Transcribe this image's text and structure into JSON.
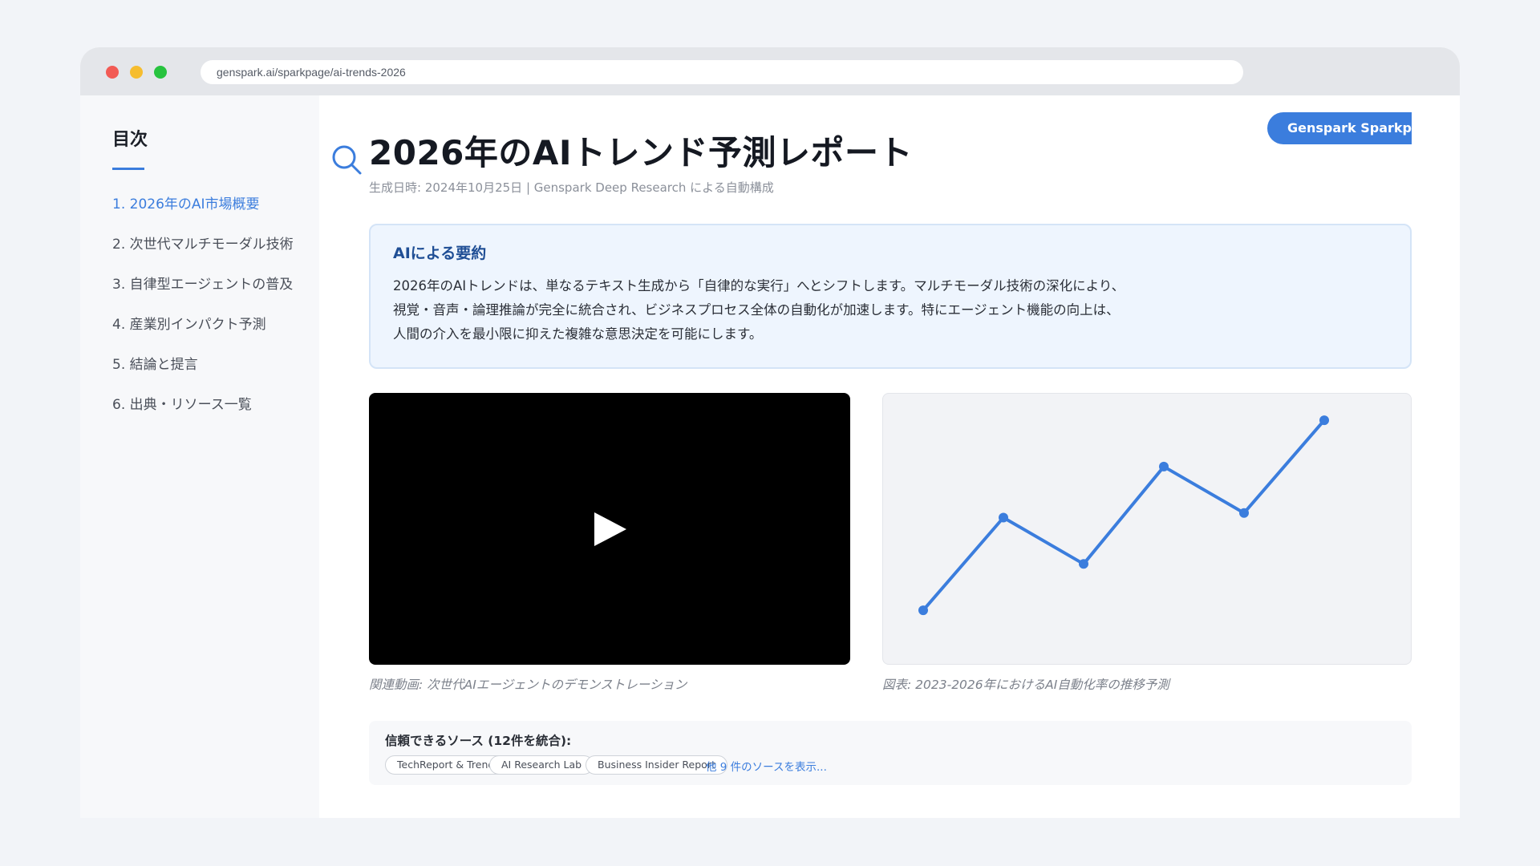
{
  "browser": {
    "url": "genspark.ai/sparkpage/ai-trends-2026"
  },
  "sidebar": {
    "title": "目次",
    "items": [
      {
        "label": "1. 2026年のAI市場概要",
        "active": true
      },
      {
        "label": "2. 次世代マルチモーダル技術",
        "active": false
      },
      {
        "label": "3. 自律型エージェントの普及",
        "active": false
      },
      {
        "label": "4. 産業別インパクト予測",
        "active": false
      },
      {
        "label": "5. 結論と提言",
        "active": false
      },
      {
        "label": "6. 出典・リソース一覧",
        "active": false
      }
    ]
  },
  "header": {
    "title": "2026年のAIトレンド予測レポート",
    "meta": "生成日時: 2024年10月25日 | Genspark Deep Research による自動構成",
    "cta_label": "Genspark Sparkpage",
    "search_icon": "search-icon"
  },
  "summary": {
    "title": "AIによる要約",
    "lines": [
      "2026年のAIトレンドは、単なるテキスト生成から「自律的な実行」へとシフトします。マルチモーダル技術の深化により、",
      "視覚・音声・論理推論が完全に統合され、ビジネスプロセス全体の自動化が加速します。特にエージェント機能の向上は、",
      "人間の介入を最小限に抑えた複雑な意思決定を可能にします。"
    ]
  },
  "media": {
    "video_caption": "関連動画: 次世代AIエージェントのデモンストレーション",
    "play_icon": "play-icon",
    "chart_caption": "図表: 2023-2026年におけるAI自動化率の推移予測"
  },
  "sources": {
    "label": "信頼できるソース (12件を統合):",
    "chips": [
      "TechReport & Trends",
      "AI Research Lab",
      "Business Insider Report"
    ],
    "more_link": "他 9 件のソースを表示..."
  },
  "colors": {
    "accent": "#3b7ddd",
    "summary_bg": "#eef5fe",
    "summary_title": "#1f4e95"
  },
  "chart_data": {
    "type": "line",
    "title": "",
    "xlabel": "",
    "ylabel": "",
    "x": [
      1,
      2,
      3,
      4,
      5,
      6
    ],
    "series": [
      {
        "values": [
          10,
          50,
          30,
          72,
          52,
          92
        ]
      }
    ],
    "ylim": [
      0,
      100
    ],
    "grid": false,
    "legend": "none",
    "color": "#3b7ddd"
  }
}
